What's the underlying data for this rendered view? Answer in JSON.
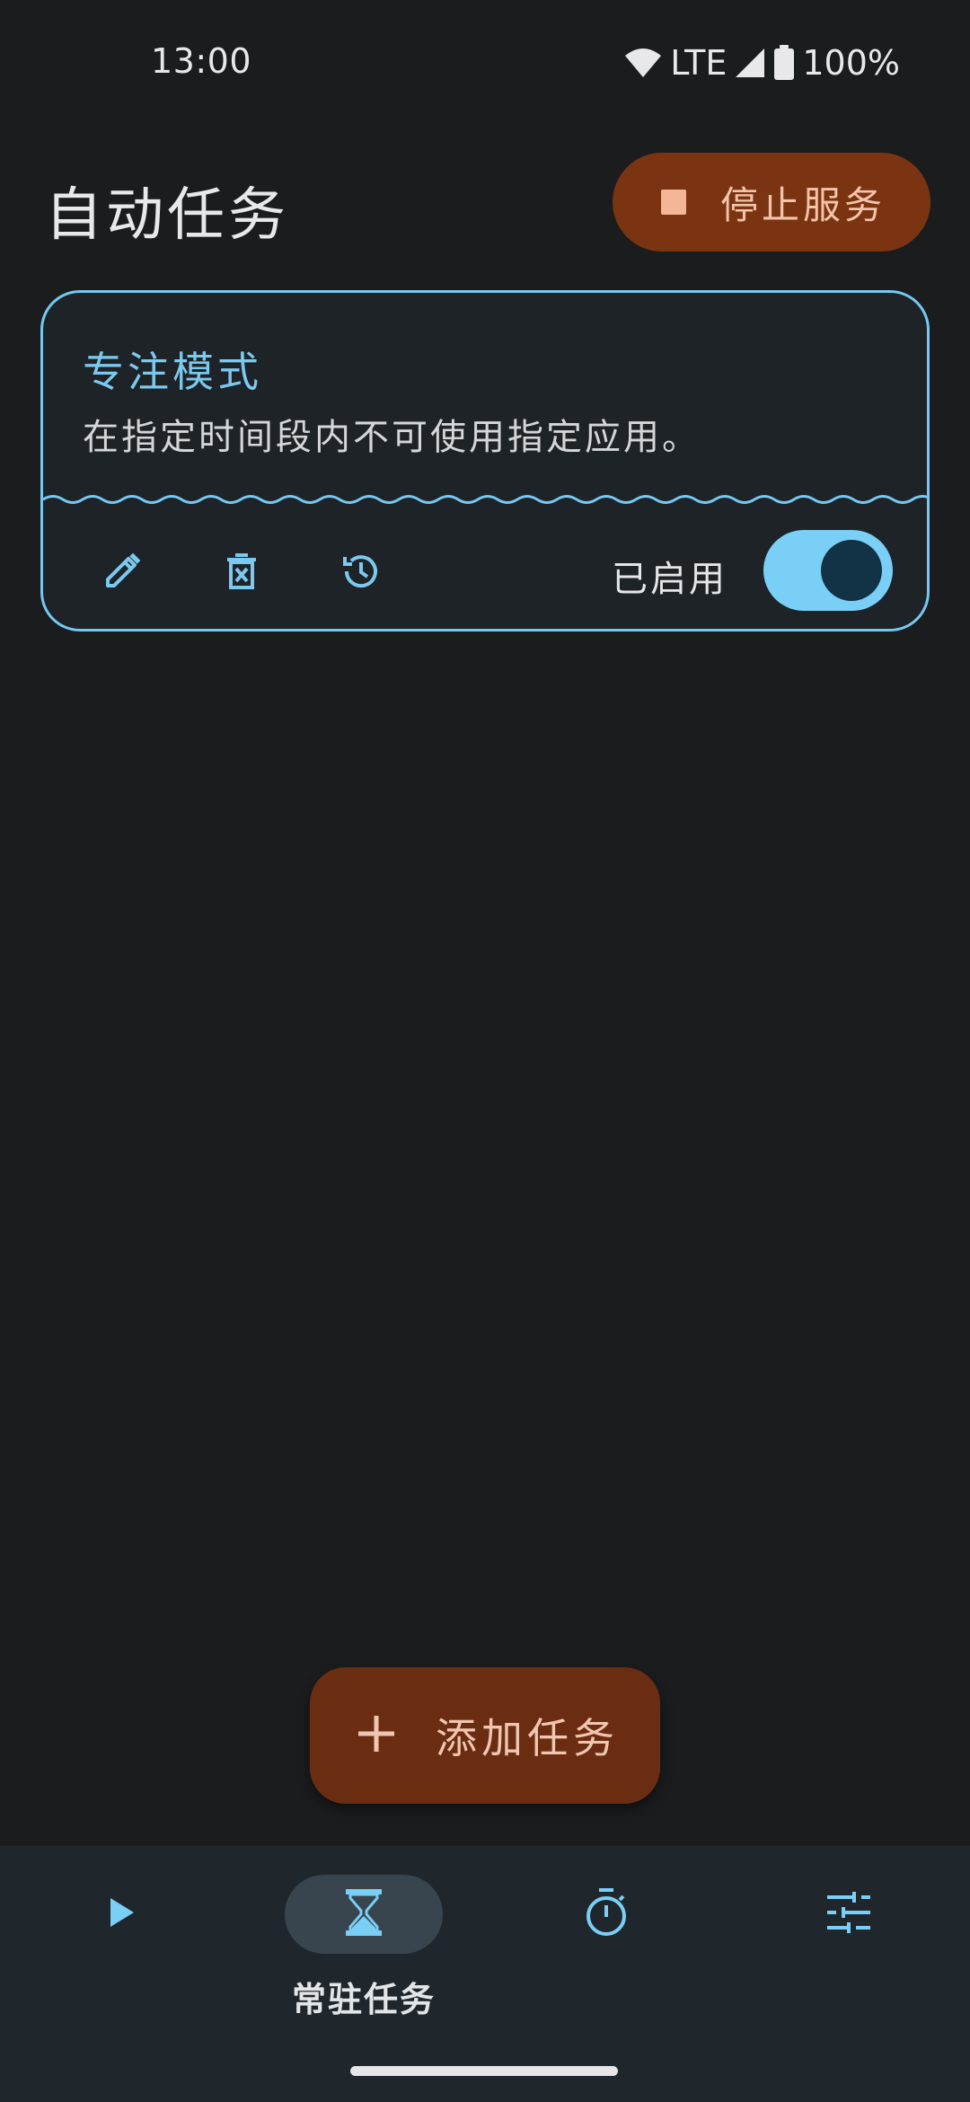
{
  "status_bar": {
    "time": "13:00",
    "network": "LTE",
    "battery": "100%"
  },
  "header": {
    "title": "自动任务",
    "stop_button_label": "停止服务"
  },
  "task_card": {
    "title": "专注模式",
    "description": "在指定时间段内不可使用指定应用。",
    "enabled_label": "已启用",
    "enabled": true,
    "actions": [
      "edit-icon",
      "delete-icon",
      "history-icon"
    ]
  },
  "fab": {
    "label": "添加任务",
    "icon": "plus-icon"
  },
  "bottom_nav": {
    "items": [
      {
        "icon": "play-icon",
        "label": ""
      },
      {
        "icon": "hourglass-icon",
        "label": "常驻任务",
        "active": true
      },
      {
        "icon": "stopwatch-icon",
        "label": ""
      },
      {
        "icon": "sliders-icon",
        "label": ""
      }
    ]
  },
  "colors": {
    "background": "#1b1c1e",
    "accent": "#7acff7",
    "stop_button": "#7a3412",
    "fab": "#6b2d12",
    "nav_background": "#1f272c"
  }
}
